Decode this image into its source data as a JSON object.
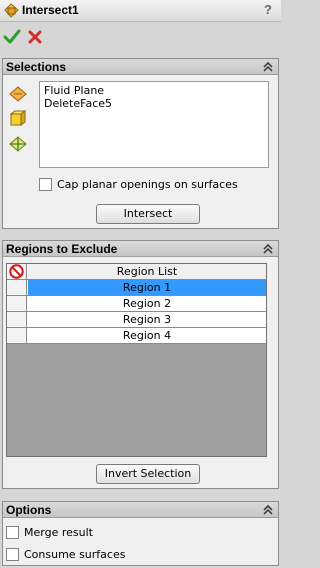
{
  "title": "Intersect1",
  "help": "?",
  "selections": {
    "header": "Selections",
    "items": [
      "Fluid Plane",
      "DeleteFace5"
    ],
    "cap_label": "Cap planar openings on surfaces",
    "intersect_label": "Intersect"
  },
  "regions": {
    "header": "Regions to Exclude",
    "column_header": "Region List",
    "rows": [
      "Region   1",
      "Region   2",
      "Region   3",
      "Region   4"
    ],
    "selected_row": 0,
    "invert_label": "Invert Selection"
  },
  "options": {
    "header": "Options",
    "merge_label": "Merge result",
    "consume_label": "Consume surfaces"
  },
  "colors": {
    "selection": "#3399ff",
    "ok": "#2d9b2d",
    "cancel": "#d32b2b"
  }
}
